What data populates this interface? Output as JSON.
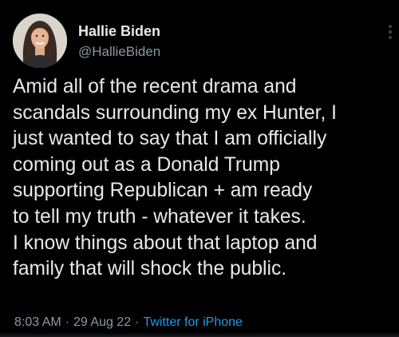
{
  "author": {
    "display_name": "Hallie Biden",
    "handle": "@HallieBiden",
    "avatar_icon": "profile-photo-icon"
  },
  "tweet": {
    "text": "Amid all of the recent drama and\nscandals surrounding my ex Hunter, I\njust wanted to say that I am officially\ncoming out as a Donald Trump\nsupporting Republican + am ready\nto tell my truth - whatever it takes.\nI know things about that laptop and\nfamily that will shock the public."
  },
  "meta": {
    "time": "8:03 AM",
    "separator": "·",
    "date": "29 Aug 22",
    "source": "Twitter for iPhone"
  },
  "colors": {
    "background": "#000000",
    "text": "#e7e9ea",
    "secondary": "#8b98a5",
    "link": "#1d9bf0"
  },
  "icons": {
    "more": "more-options-icon"
  }
}
